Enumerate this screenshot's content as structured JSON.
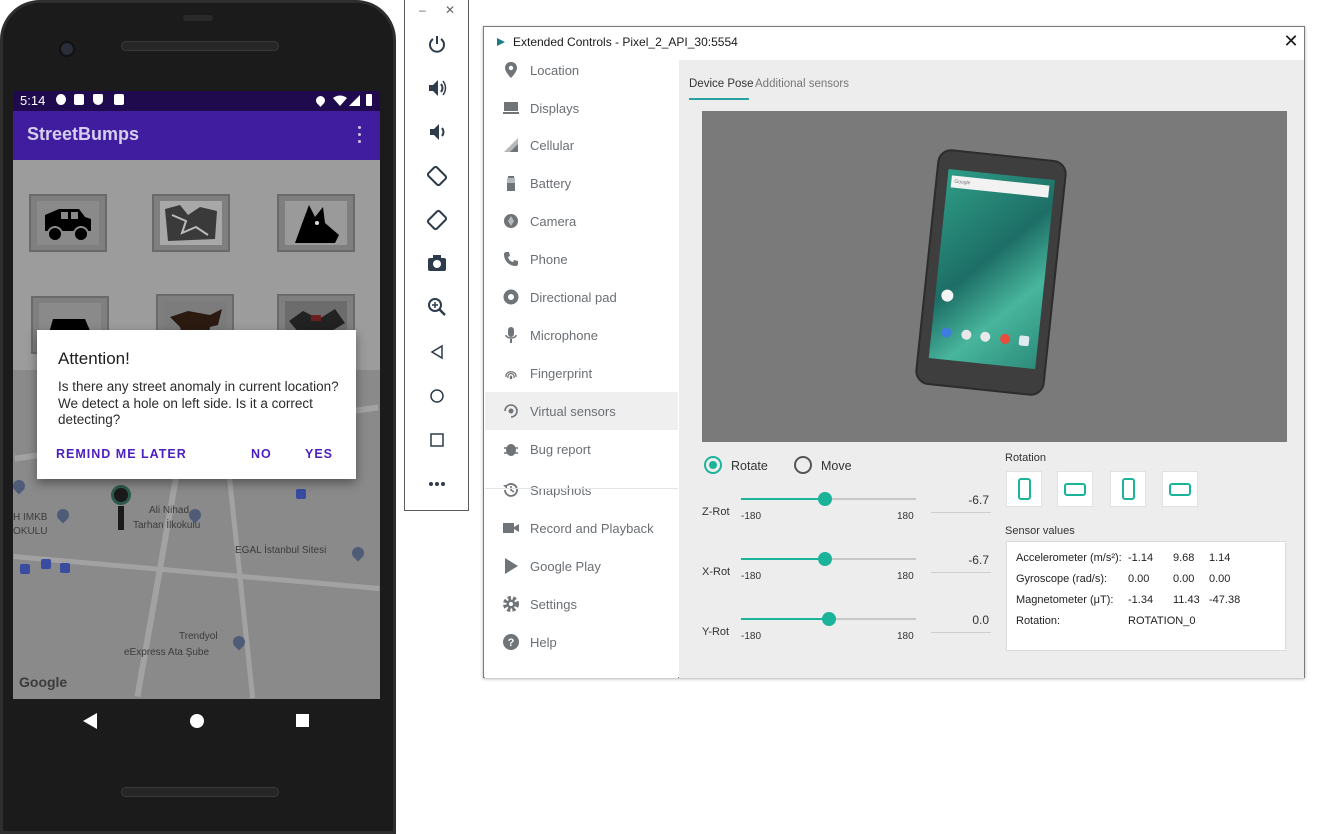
{
  "phone": {
    "status_time": "5:14",
    "app_title": "StreetBumps",
    "dialog": {
      "title": "Attention!",
      "message": "Is there any street anomaly in current location? We detect a hole on left side. Is it a correct detecting?",
      "remind_label": "REMIND ME LATER",
      "no_label": "NO",
      "yes_label": "YES"
    },
    "map_labels": {
      "ali_nihad": "Ali Nihad",
      "tarhan": "Tarhan İlkokulu",
      "imkb": "H IMKB",
      "okulu": "OKULU",
      "egal": "EGAL İstanbul Sitesi",
      "trendyol": "Trendyol",
      "express": "eExpress Ata Şube",
      "google": "Google"
    }
  },
  "toolbar": {
    "minimize": "–",
    "close": "✕",
    "buttons": [
      "power-icon",
      "volume-up-icon",
      "volume-down-icon",
      "rotate-left-icon",
      "rotate-right-icon",
      "camera-icon",
      "zoom-icon",
      "back-icon",
      "home-icon",
      "overview-icon",
      "more-icon"
    ]
  },
  "window": {
    "title": "Extended Controls - Pixel_2_API_30:5554",
    "close": "✕",
    "nav": [
      {
        "label": "Location",
        "icon": "location-pin-icon"
      },
      {
        "label": "Displays",
        "icon": "display-icon"
      },
      {
        "label": "Cellular",
        "icon": "cellular-icon"
      },
      {
        "label": "Battery",
        "icon": "battery-icon"
      },
      {
        "label": "Camera",
        "icon": "camera-aperture-icon"
      },
      {
        "label": "Phone",
        "icon": "phone-icon"
      },
      {
        "label": "Directional pad",
        "icon": "dpad-icon"
      },
      {
        "label": "Microphone",
        "icon": "microphone-icon"
      },
      {
        "label": "Fingerprint",
        "icon": "fingerprint-icon"
      },
      {
        "label": "Virtual sensors",
        "icon": "virtual-sensors-icon"
      },
      {
        "label": "Bug report",
        "icon": "bug-icon"
      },
      {
        "label": "Snapshots",
        "icon": "history-icon"
      },
      {
        "label": "Record and Playback",
        "icon": "video-icon"
      },
      {
        "label": "Google Play",
        "icon": "play-store-icon"
      },
      {
        "label": "Settings",
        "icon": "gear-icon"
      },
      {
        "label": "Help",
        "icon": "help-icon"
      }
    ],
    "active_nav": "Virtual sensors",
    "tabs": {
      "device_pose": "Device Pose",
      "additional": "Additional sensors"
    },
    "device_search_text": "Google",
    "mode": {
      "rotate": "Rotate",
      "move": "Move",
      "selected": "rotate"
    },
    "sliders": [
      {
        "label": "Z-Rot",
        "min": "-180",
        "max": "180",
        "value": "-6.7",
        "level": -6.7
      },
      {
        "label": "X-Rot",
        "min": "-180",
        "max": "180",
        "value": "-6.7",
        "level": -6.7
      },
      {
        "label": "Y-Rot",
        "min": "-180",
        "max": "180",
        "value": "0.0",
        "level": 0.0
      }
    ],
    "rotation_label": "Rotation",
    "sensor_values_label": "Sensor values",
    "sensors": [
      {
        "name": "Accelerometer (m/s²):",
        "v1": "-1.14",
        "v2": "9.68",
        "v3": "1.14"
      },
      {
        "name": "Gyroscope (rad/s):",
        "v1": "0.00",
        "v2": "0.00",
        "v3": "0.00"
      },
      {
        "name": "Magnetometer (μT):",
        "v1": "-1.34",
        "v2": "11.43",
        "v3": "-47.38"
      },
      {
        "name": "Rotation:",
        "v1": "ROTATION_0",
        "v2": "",
        "v3": ""
      }
    ],
    "accent_color": "#1bb39a"
  }
}
